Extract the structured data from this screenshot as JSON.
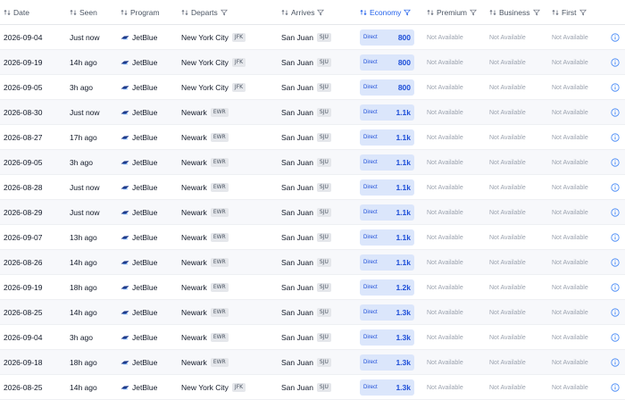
{
  "columns": [
    {
      "key": "date",
      "label": "Date",
      "sort_icon": "sort-icon",
      "filter": false
    },
    {
      "key": "seen",
      "label": "Seen",
      "sort_icon": "sort-icon",
      "filter": false
    },
    {
      "key": "program",
      "label": "Program",
      "sort_icon": "sort-icon",
      "filter": false
    },
    {
      "key": "departs",
      "label": "Departs",
      "sort_icon": "sort-icon",
      "filter": true
    },
    {
      "key": "arrives",
      "label": "Arrives",
      "sort_icon": "sort-icon",
      "filter": true
    },
    {
      "key": "economy",
      "label": "Economy",
      "sort_icon": "sort-icon",
      "filter": true,
      "active": true
    },
    {
      "key": "premium",
      "label": "Premium",
      "sort_icon": "sort-icon",
      "filter": true
    },
    {
      "key": "business",
      "label": "Business",
      "sort_icon": "sort-icon",
      "filter": true
    },
    {
      "key": "first",
      "label": "First",
      "sort_icon": "sort-icon",
      "filter": true
    }
  ],
  "colors": {
    "accent": "#2563eb",
    "economy_badge_bg": "#dbe6fb",
    "code_badge_bg": "#e5e7eb",
    "row_alt_bg": "#f7f8fb"
  },
  "rows": [
    {
      "date": "2026-09-04",
      "seen": "Just now",
      "program": "JetBlue",
      "departs": "New York City",
      "departs_code": "JFK",
      "arrives": "San Juan",
      "arrives_code": "SJU",
      "economy_type": "Direct",
      "economy_price": "800",
      "premium": "Not Available",
      "business": "Not Available",
      "first": "Not Available"
    },
    {
      "date": "2026-09-19",
      "seen": "14h ago",
      "program": "JetBlue",
      "departs": "New York City",
      "departs_code": "JFK",
      "arrives": "San Juan",
      "arrives_code": "SJU",
      "economy_type": "Direct",
      "economy_price": "800",
      "premium": "Not Available",
      "business": "Not Available",
      "first": "Not Available"
    },
    {
      "date": "2026-09-05",
      "seen": "3h ago",
      "program": "JetBlue",
      "departs": "New York City",
      "departs_code": "JFK",
      "arrives": "San Juan",
      "arrives_code": "SJU",
      "economy_type": "Direct",
      "economy_price": "800",
      "premium": "Not Available",
      "business": "Not Available",
      "first": "Not Available"
    },
    {
      "date": "2026-08-30",
      "seen": "Just now",
      "program": "JetBlue",
      "departs": "Newark",
      "departs_code": "EWR",
      "arrives": "San Juan",
      "arrives_code": "SJU",
      "economy_type": "Direct",
      "economy_price": "1.1k",
      "premium": "Not Available",
      "business": "Not Available",
      "first": "Not Available"
    },
    {
      "date": "2026-08-27",
      "seen": "17h ago",
      "program": "JetBlue",
      "departs": "Newark",
      "departs_code": "EWR",
      "arrives": "San Juan",
      "arrives_code": "SJU",
      "economy_type": "Direct",
      "economy_price": "1.1k",
      "premium": "Not Available",
      "business": "Not Available",
      "first": "Not Available"
    },
    {
      "date": "2026-09-05",
      "seen": "3h ago",
      "program": "JetBlue",
      "departs": "Newark",
      "departs_code": "EWR",
      "arrives": "San Juan",
      "arrives_code": "SJU",
      "economy_type": "Direct",
      "economy_price": "1.1k",
      "premium": "Not Available",
      "business": "Not Available",
      "first": "Not Available"
    },
    {
      "date": "2026-08-28",
      "seen": "Just now",
      "program": "JetBlue",
      "departs": "Newark",
      "departs_code": "EWR",
      "arrives": "San Juan",
      "arrives_code": "SJU",
      "economy_type": "Direct",
      "economy_price": "1.1k",
      "premium": "Not Available",
      "business": "Not Available",
      "first": "Not Available"
    },
    {
      "date": "2026-08-29",
      "seen": "Just now",
      "program": "JetBlue",
      "departs": "Newark",
      "departs_code": "EWR",
      "arrives": "San Juan",
      "arrives_code": "SJU",
      "economy_type": "Direct",
      "economy_price": "1.1k",
      "premium": "Not Available",
      "business": "Not Available",
      "first": "Not Available"
    },
    {
      "date": "2026-09-07",
      "seen": "13h ago",
      "program": "JetBlue",
      "departs": "Newark",
      "departs_code": "EWR",
      "arrives": "San Juan",
      "arrives_code": "SJU",
      "economy_type": "Direct",
      "economy_price": "1.1k",
      "premium": "Not Available",
      "business": "Not Available",
      "first": "Not Available"
    },
    {
      "date": "2026-08-26",
      "seen": "14h ago",
      "program": "JetBlue",
      "departs": "Newark",
      "departs_code": "EWR",
      "arrives": "San Juan",
      "arrives_code": "SJU",
      "economy_type": "Direct",
      "economy_price": "1.1k",
      "premium": "Not Available",
      "business": "Not Available",
      "first": "Not Available"
    },
    {
      "date": "2026-09-19",
      "seen": "18h ago",
      "program": "JetBlue",
      "departs": "Newark",
      "departs_code": "EWR",
      "arrives": "San Juan",
      "arrives_code": "SJU",
      "economy_type": "Direct",
      "economy_price": "1.2k",
      "premium": "Not Available",
      "business": "Not Available",
      "first": "Not Available"
    },
    {
      "date": "2026-08-25",
      "seen": "14h ago",
      "program": "JetBlue",
      "departs": "Newark",
      "departs_code": "EWR",
      "arrives": "San Juan",
      "arrives_code": "SJU",
      "economy_type": "Direct",
      "economy_price": "1.3k",
      "premium": "Not Available",
      "business": "Not Available",
      "first": "Not Available"
    },
    {
      "date": "2026-09-04",
      "seen": "3h ago",
      "program": "JetBlue",
      "departs": "Newark",
      "departs_code": "EWR",
      "arrives": "San Juan",
      "arrives_code": "SJU",
      "economy_type": "Direct",
      "economy_price": "1.3k",
      "premium": "Not Available",
      "business": "Not Available",
      "first": "Not Available"
    },
    {
      "date": "2026-09-18",
      "seen": "18h ago",
      "program": "JetBlue",
      "departs": "Newark",
      "departs_code": "EWR",
      "arrives": "San Juan",
      "arrives_code": "SJU",
      "economy_type": "Direct",
      "economy_price": "1.3k",
      "premium": "Not Available",
      "business": "Not Available",
      "first": "Not Available"
    },
    {
      "date": "2026-08-25",
      "seen": "14h ago",
      "program": "JetBlue",
      "departs": "New York City",
      "departs_code": "JFK",
      "arrives": "San Juan",
      "arrives_code": "SJU",
      "economy_type": "Direct",
      "economy_price": "1.3k",
      "premium": "Not Available",
      "business": "Not Available",
      "first": "Not Available"
    }
  ]
}
